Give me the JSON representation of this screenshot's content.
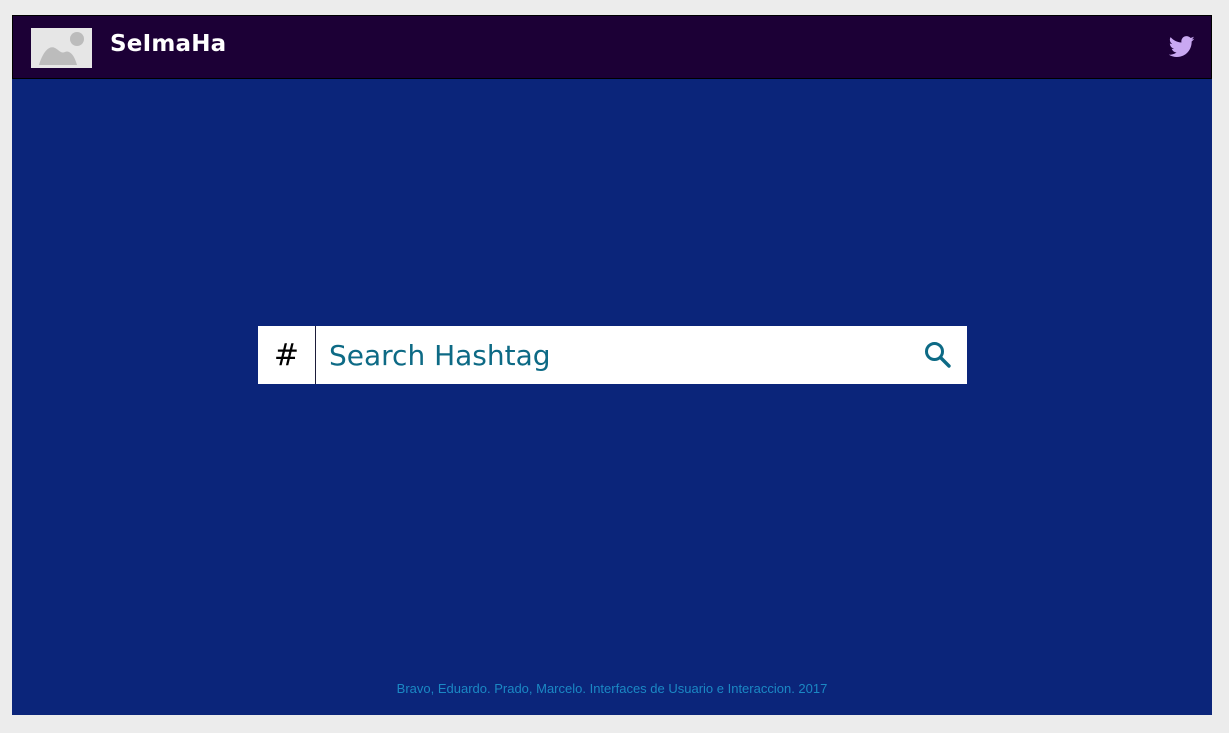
{
  "header": {
    "brand": "SeImaHa",
    "logo_icon": "image-placeholder-icon",
    "social_icon": "twitter-icon",
    "background_color": "#1c0036"
  },
  "search": {
    "prefix": "#",
    "placeholder": "Search Hashtag",
    "value": "",
    "button_icon": "search-icon",
    "accent_color": "#0d6a85"
  },
  "main": {
    "background_color": "#0b257a"
  },
  "footer": {
    "text": "Bravo, Eduardo. Prado, Marcelo. Interfaces de Usuario e Interaccion. 2017",
    "color": "#1b88c4"
  }
}
